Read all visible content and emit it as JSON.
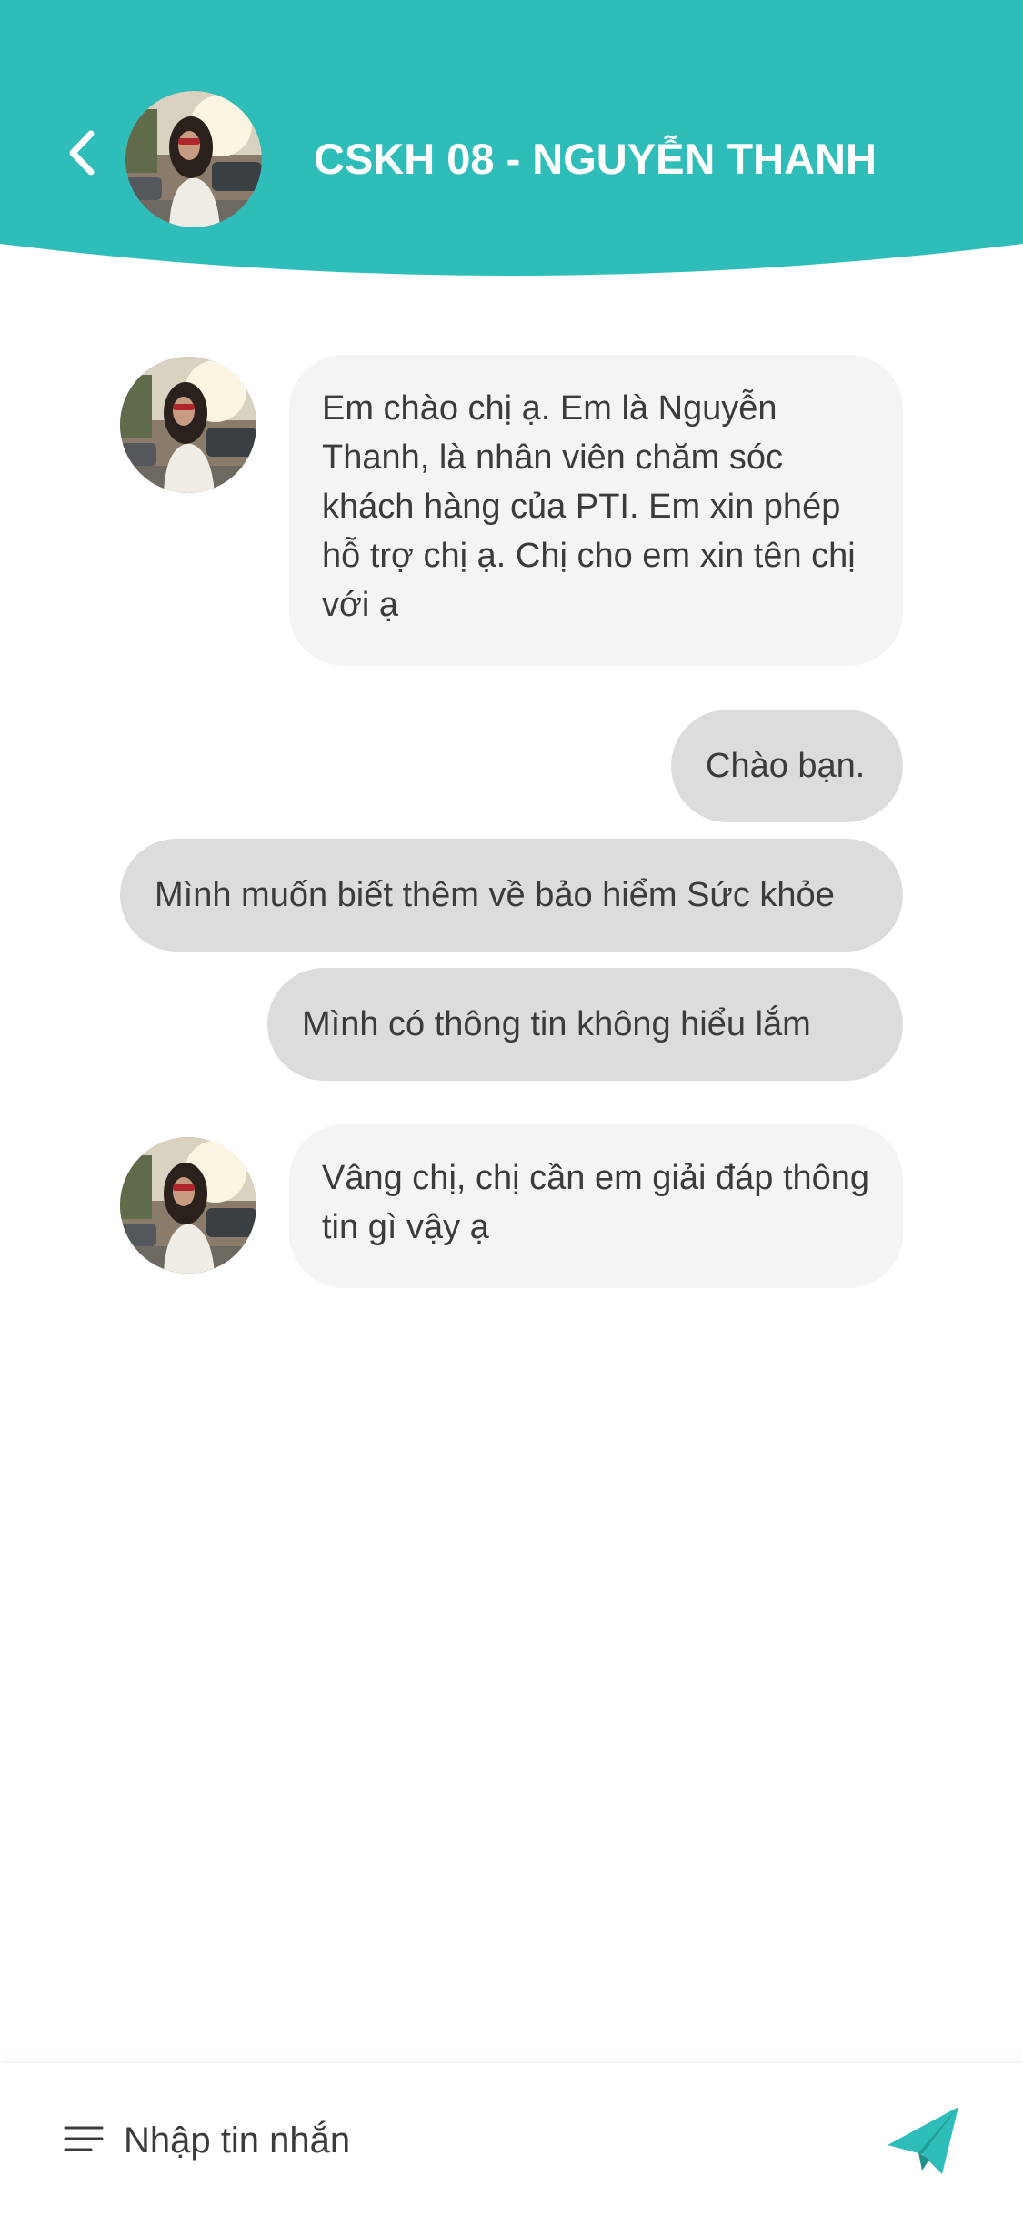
{
  "colors": {
    "accent": "#2ebdb9",
    "incoming_bubble": "#f4f4f4",
    "outgoing_bubble": "#dcdcdc",
    "text": "#3b3b3b"
  },
  "header": {
    "title": "CSKH 08 - NGUYỄN THANH",
    "back_icon": "chevron-left-icon",
    "avatar": "agent-avatar"
  },
  "messages": [
    {
      "from": "agent",
      "text": "Em chào chị ạ. Em là Nguyễn Thanh, là nhân viên chăm sóc khách hàng của PTI. Em xin phép hỗ trợ chị ạ. Chị cho em xin tên chị với ạ"
    },
    {
      "from": "user",
      "text": "Chào bạn."
    },
    {
      "from": "user",
      "text": "Mình muốn biết thêm về bảo hiểm Sức khỏe"
    },
    {
      "from": "user",
      "text": "Mình có thông tin không hiểu lắm"
    },
    {
      "from": "agent",
      "text": "Vâng chị, chị cần em giải đáp thông tin gì vậy ạ"
    }
  ],
  "composer": {
    "placeholder": "Nhập tin nhắn",
    "menu_icon": "menu-lines-icon",
    "send_icon": "send-icon"
  }
}
